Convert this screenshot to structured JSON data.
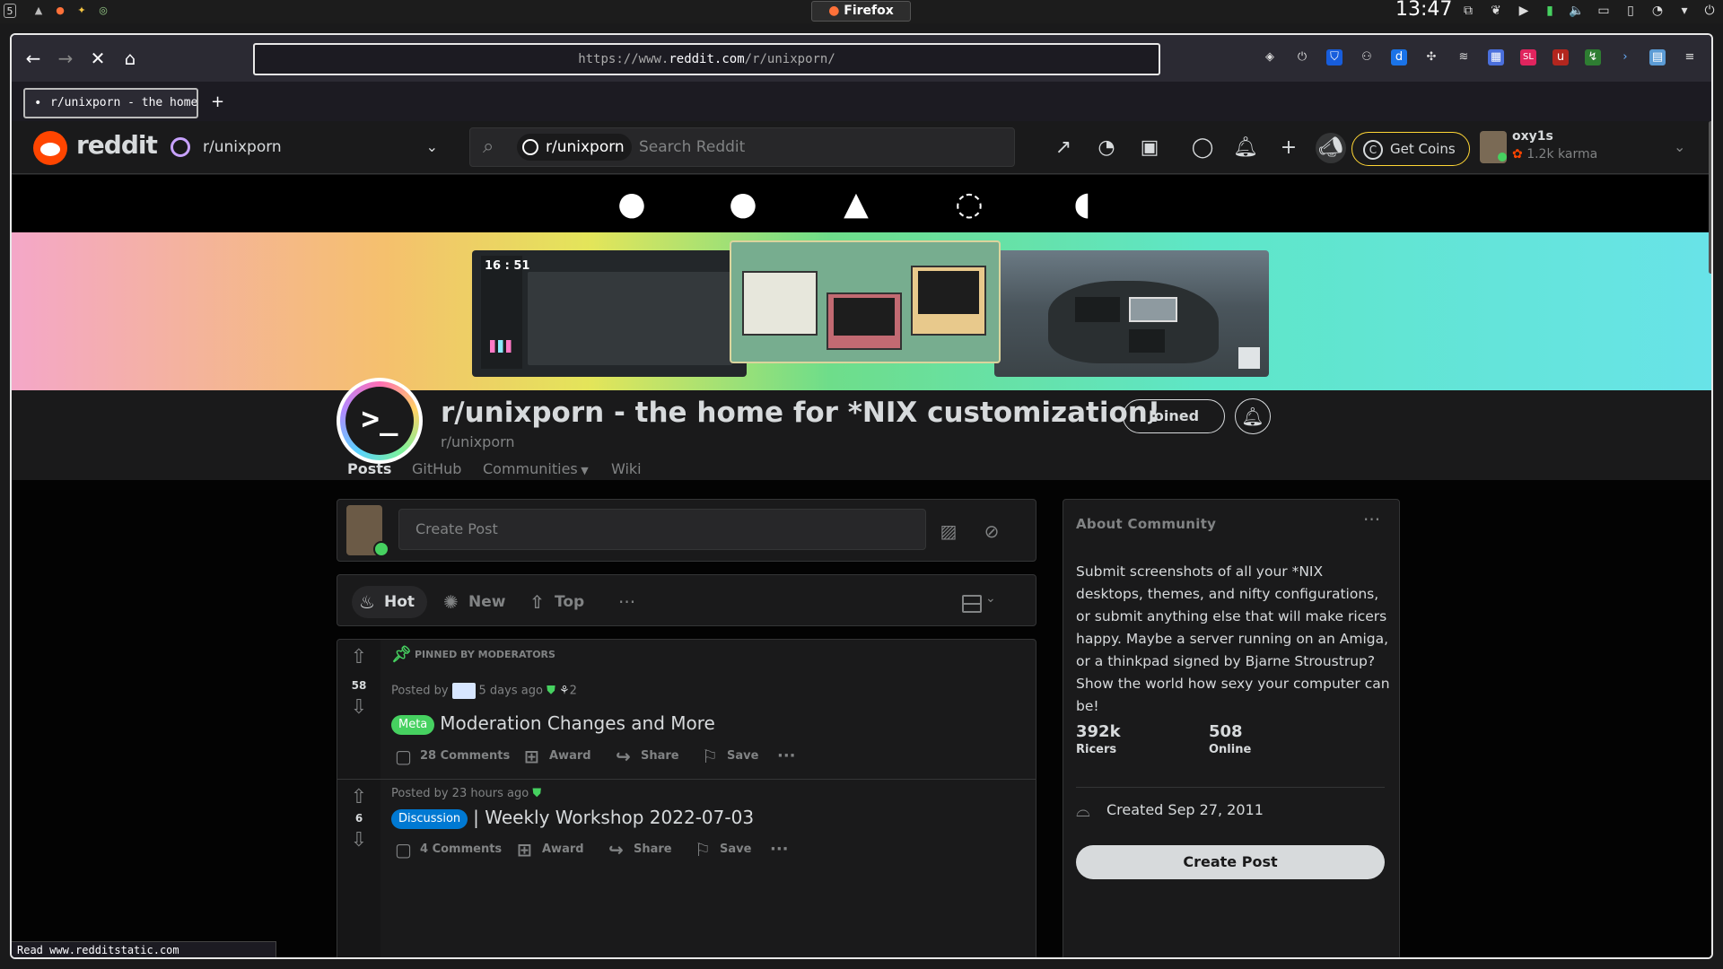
{
  "system": {
    "workspace": "5",
    "window_title": "Firefox",
    "clock": "13:47"
  },
  "browser": {
    "url_prefix": "https://www.",
    "url_host": "reddit.com",
    "url_path": "/r/unixporn/",
    "tab_title": "r/unixporn - the home for *NIX customization!",
    "new_tab": "+",
    "status_text": "Read www.redditstatic.com"
  },
  "header": {
    "logo_text": "reddit",
    "community_selector": "r/unixporn",
    "search_chip": "r/unixporn",
    "search_placeholder": "Search Reddit",
    "get_coins": "Get Coins",
    "username": "oxy1s",
    "karma": "1.2k karma"
  },
  "distros": [
    "freebsd",
    "apple",
    "arch",
    "debian",
    "gentoo"
  ],
  "subreddit": {
    "icon_text": ">_",
    "title": "r/unixporn - the home for *NIX customization!",
    "name": "r/unixporn",
    "joined_label": "Joined",
    "banner_clock": "16 : 51",
    "tabs": [
      {
        "label": "Posts",
        "active": true
      },
      {
        "label": "GitHub",
        "active": false
      },
      {
        "label": "Communities",
        "active": false
      },
      {
        "label": "Wiki",
        "active": false
      }
    ]
  },
  "create_post": {
    "placeholder": "Create Post"
  },
  "sort": {
    "hot": "Hot",
    "new": "New",
    "top": "Top",
    "more": "···"
  },
  "posts": [
    {
      "pinned_label": "PINNED BY MODERATORS",
      "votes": "58",
      "posted_by": "Posted by",
      "age": "5 days ago",
      "award_count": "2",
      "flair": "Meta",
      "flair_color": "#46d160",
      "title": "Moderation Changes and More",
      "comments": "28 Comments",
      "award": "Award",
      "share": "Share",
      "save": "Save"
    },
    {
      "votes": "6",
      "posted_by": "Posted by",
      "age": "23 hours ago",
      "flair": "Discussion",
      "flair_color": "#0079d3",
      "title": "| Weekly Workshop 2022-07-03",
      "comments": "4 Comments",
      "award": "Award",
      "share": "Share",
      "save": "Save"
    }
  ],
  "about": {
    "heading": "About Community",
    "description": "Submit screenshots of all your *NIX desktops, themes, and nifty configurations, or submit anything else that will make ricers happy. Maybe a server running on an Amiga, or a thinkpad signed by Bjarne Stroustrup? Show the world how sexy your computer can be!",
    "members_value": "392k",
    "members_label": "Ricers",
    "online_value": "508",
    "online_label": "Online",
    "created": "Created Sep 27, 2011",
    "create_post": "Create Post"
  },
  "colors": {
    "reddit_orange": "#ff4500",
    "meta_flair": "#46d160",
    "discussion_flair": "#0079d3",
    "coins_border": "#ffd635"
  }
}
